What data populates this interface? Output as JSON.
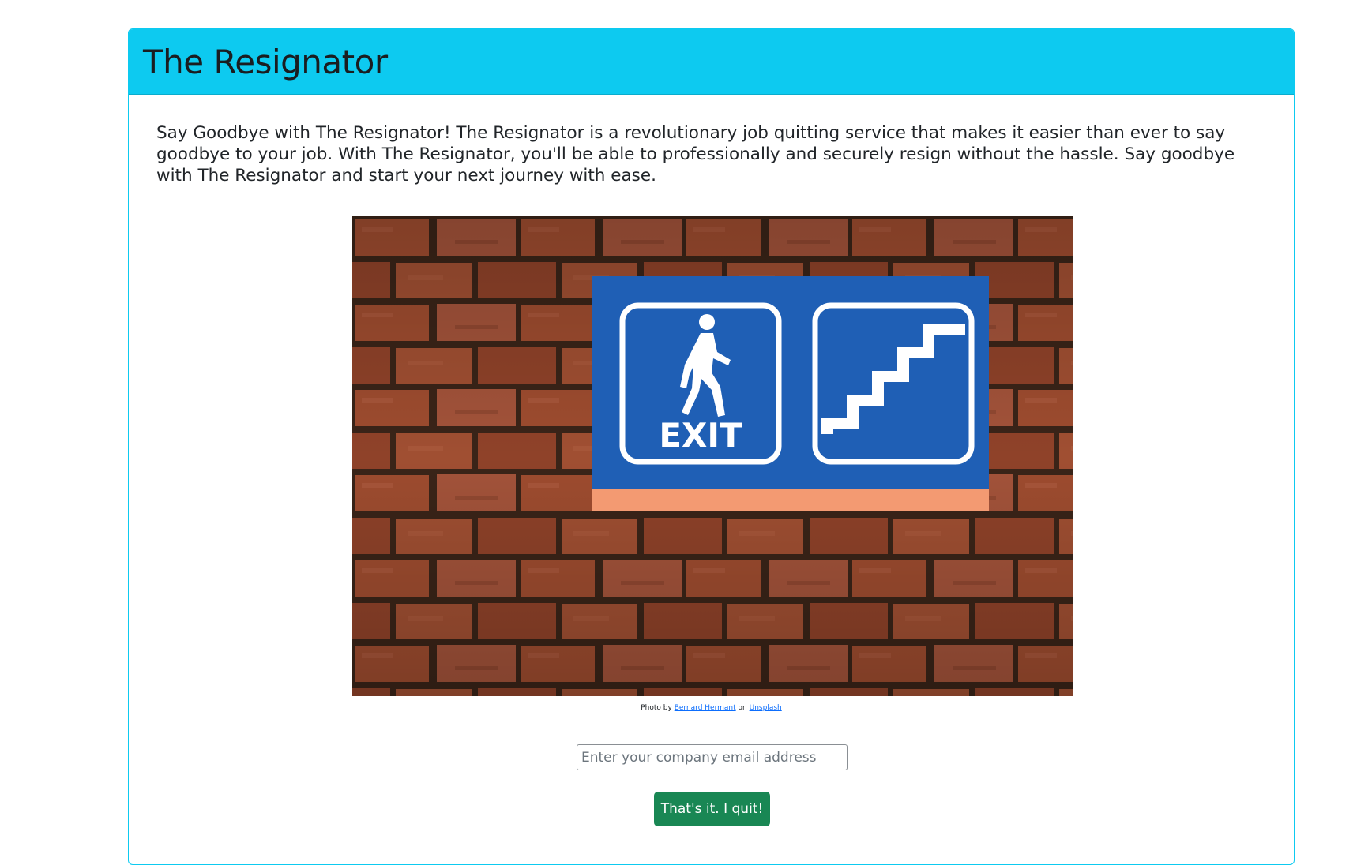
{
  "header": {
    "title": "The Resignator"
  },
  "main": {
    "intro": "Say Goodbye with The Resignator! The Resignator is a revolutionary job quitting service that makes it easier than ever to say goodbye to your job. With The Resignator, you'll be able to professionally and securely resign without the hassle. Say goodbye with The Resignator and start your next journey with ease.",
    "photo": {
      "sign_text": "EXIT",
      "icons": [
        "walking-person-icon",
        "stairs-icon"
      ]
    },
    "credit": {
      "prefix": "Photo by",
      "author": "Bernard Hermant",
      "middle": "on",
      "site": "Unsplash"
    },
    "form": {
      "email_placeholder": "Enter your company email address",
      "email_value": "",
      "submit_label": "That's it. I quit!"
    }
  },
  "colors": {
    "header_bg": "#0dcaf0",
    "button_bg": "#198754",
    "sign_blue": "#1f5fb5",
    "sign_stripe": "#f39a72",
    "brick": "#9a4a2e",
    "mortar": "#3a2418"
  }
}
